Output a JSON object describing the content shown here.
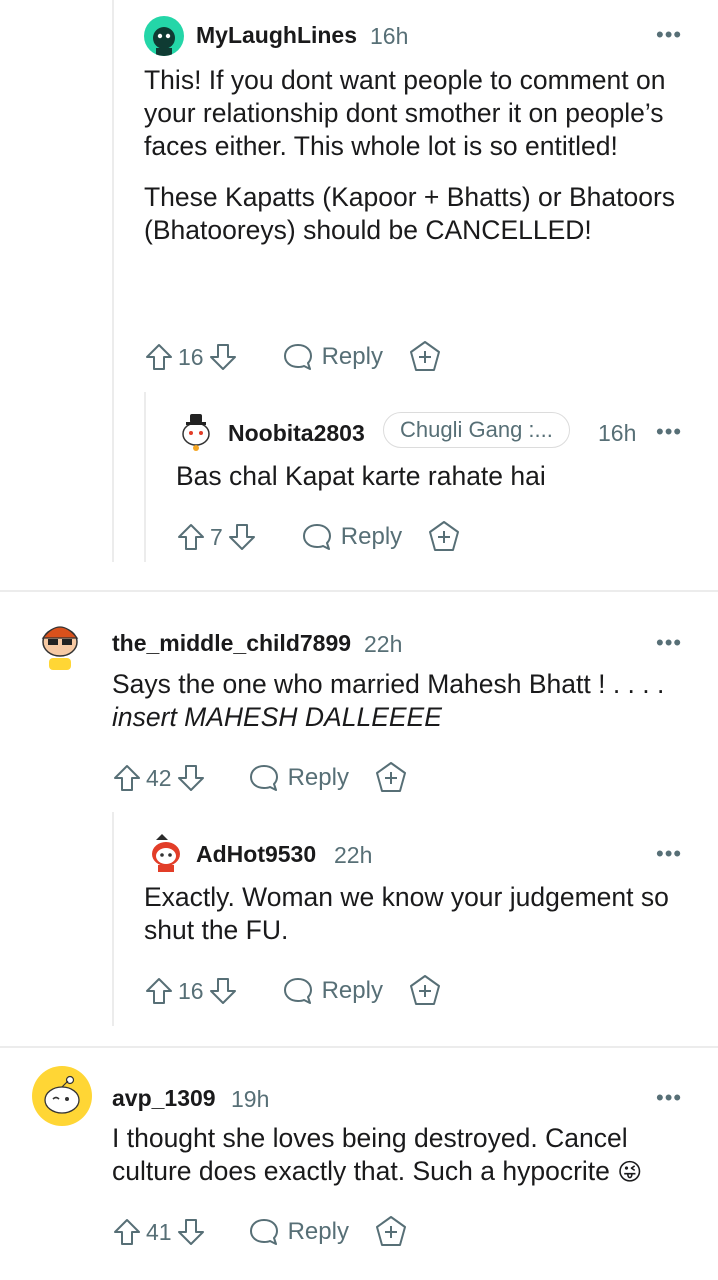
{
  "comments": [
    {
      "username": "MyLaughLines",
      "time": "16h",
      "paragraphs": [
        "This! If you dont want people to comment on your relationship dont smother it on people’s faces either. This whole lot is so entitled!",
        "These Kapatts (Kapoor + Bhatts) or Bhatoors (Bhatooreys) should be CANCELLED!"
      ],
      "votes": "16",
      "reply_label": "Reply",
      "avatar_color": "#24d6a8"
    },
    {
      "username": "Noobita2803",
      "flair": "Chugli Gang :...",
      "time": "16h",
      "paragraphs": [
        "Bas chal Kapat karte rahate hai"
      ],
      "votes": "7",
      "reply_label": "Reply"
    },
    {
      "username": "the_middle_child7899",
      "time": "22h",
      "text_plain": "Says the one who married Mahesh Bhatt ! . . . .",
      "text_italic": "insert MAHESH DALLEEEE",
      "votes": "42",
      "reply_label": "Reply"
    },
    {
      "username": "AdHot9530",
      "time": "22h",
      "paragraphs": [
        "Exactly. Woman we know your judgement so shut the FU."
      ],
      "votes": "16",
      "reply_label": "Reply"
    },
    {
      "username": "avp_1309",
      "time": "19h",
      "paragraphs": [
        "I thought she loves being destroyed. Cancel culture does exactly that. Such a hypocrite"
      ],
      "emoji": "😜",
      "votes": "41",
      "reply_label": "Reply"
    }
  ],
  "menu_glyph": "•••",
  "icons": [
    "upvote-icon",
    "downvote-icon",
    "reply-bubble-icon",
    "award-plus-icon",
    "more-options-icon"
  ],
  "colors": {
    "meta": "#576f76",
    "text": "#1a1a1b",
    "thread": "#ececec"
  }
}
